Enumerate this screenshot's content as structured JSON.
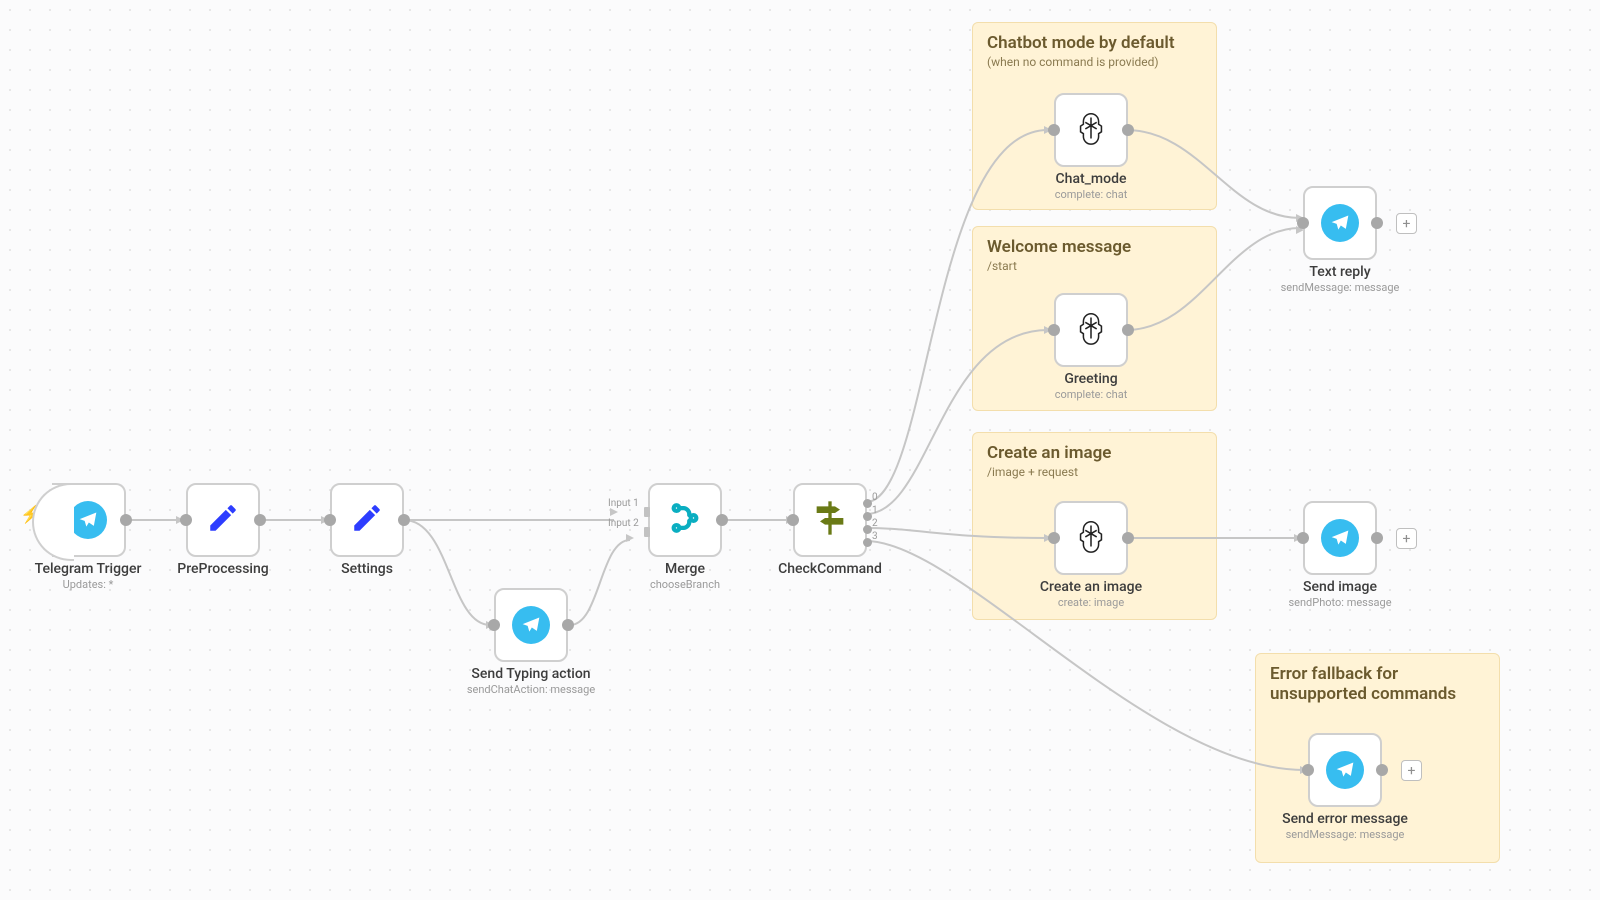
{
  "nodes": {
    "trigger": {
      "label": "Telegram Trigger",
      "sub": "Updates: *"
    },
    "preprocessing": {
      "label": "PreProcessing"
    },
    "settings": {
      "label": "Settings"
    },
    "typing": {
      "label": "Send Typing action",
      "sub": "sendChatAction: message"
    },
    "merge": {
      "label": "Merge",
      "sub": "chooseBranch",
      "inputs": [
        "Input 1",
        "Input 2"
      ]
    },
    "check": {
      "label": "CheckCommand",
      "outputs": [
        "0",
        "1",
        "2",
        "3"
      ]
    },
    "chatmode": {
      "label": "Chat_mode",
      "sub": "complete: chat"
    },
    "greeting": {
      "label": "Greeting",
      "sub": "complete: chat"
    },
    "createimage": {
      "label": "Create an image",
      "sub": "create: image"
    },
    "textreply": {
      "label": "Text reply",
      "sub": "sendMessage: message"
    },
    "sendimage": {
      "label": "Send image",
      "sub": "sendPhoto: message"
    },
    "senderror": {
      "label": "Send error message",
      "sub": "sendMessage: message"
    }
  },
  "stickies": {
    "default": {
      "title": "Chatbot mode by default",
      "sub": "(when no command is provided)"
    },
    "welcome": {
      "title": "Welcome message",
      "sub": "/start"
    },
    "image": {
      "title": "Create an image",
      "sub": "/image + request"
    },
    "error": {
      "title": "Error fallback for unsupported commands",
      "sub": ""
    }
  },
  "glyphs": {
    "plus": "+"
  }
}
